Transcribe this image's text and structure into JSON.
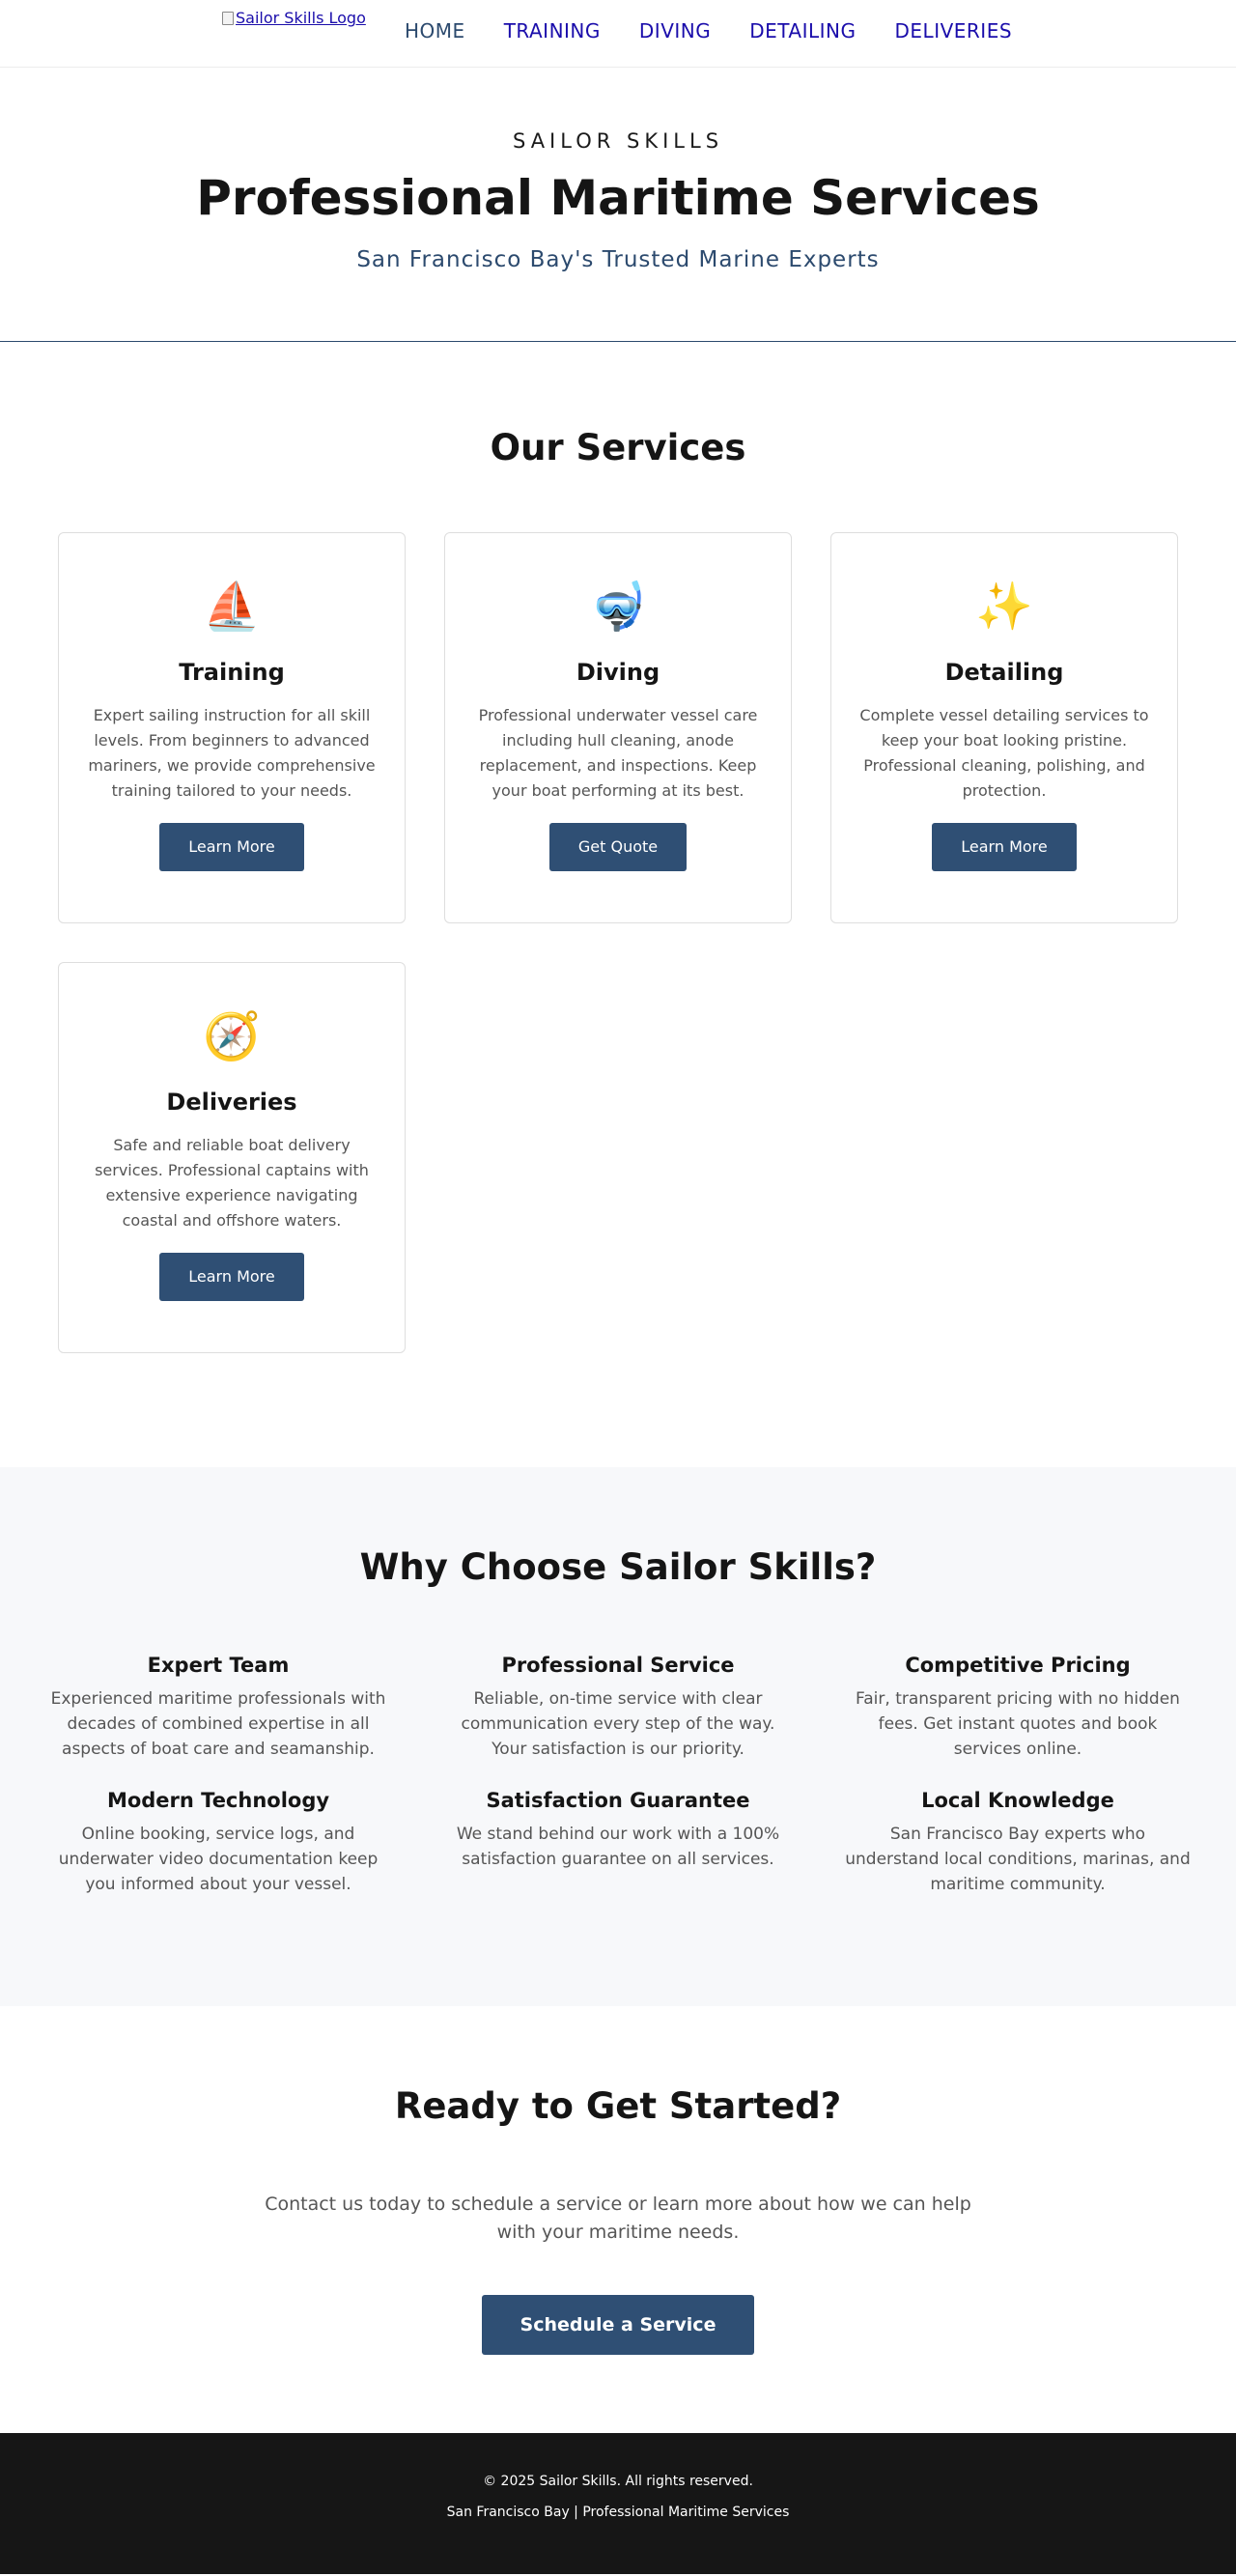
{
  "nav": {
    "logo_alt": "Sailor Skills Logo",
    "links": [
      "HOME",
      "TRAINING",
      "DIVING",
      "DETAILING",
      "DELIVERIES"
    ]
  },
  "hero": {
    "eyebrow": "SAILOR SKILLS",
    "title": "Professional Maritime Services",
    "tagline": "San Francisco Bay's Trusted Marine Experts"
  },
  "services": {
    "title": "Our Services",
    "cards": [
      {
        "icon": "⛵",
        "icon_name": "sailboat-icon",
        "title": "Training",
        "description": "Expert sailing instruction for all skill levels. From beginners to advanced mariners, we provide comprehensive training tailored to your needs.",
        "button": "Learn More"
      },
      {
        "icon": "🤿",
        "icon_name": "diving-mask-icon",
        "title": "Diving",
        "description": "Professional underwater vessel care including hull cleaning, anode replacement, and inspections. Keep your boat performing at its best.",
        "button": "Get Quote"
      },
      {
        "icon": "✨",
        "icon_name": "sparkles-icon",
        "title": "Detailing",
        "description": "Complete vessel detailing services to keep your boat looking pristine. Professional cleaning, polishing, and protection.",
        "button": "Learn More"
      },
      {
        "icon": "🧭",
        "icon_name": "compass-icon",
        "title": "Deliveries",
        "description": "Safe and reliable boat delivery services. Professional captains with extensive experience navigating coastal and offshore waters.",
        "button": "Learn More"
      }
    ]
  },
  "why": {
    "title": "Why Choose Sailor Skills?",
    "features": [
      {
        "title": "Expert Team",
        "text": "Experienced maritime professionals with decades of combined expertise in all aspects of boat care and seamanship."
      },
      {
        "title": "Professional Service",
        "text": "Reliable, on-time service with clear communication every step of the way. Your satisfaction is our priority."
      },
      {
        "title": "Competitive Pricing",
        "text": "Fair, transparent pricing with no hidden fees. Get instant quotes and book services online."
      },
      {
        "title": "Modern Technology",
        "text": "Online booking, service logs, and underwater video documentation keep you informed about your vessel."
      },
      {
        "title": "Satisfaction Guarantee",
        "text": "We stand behind our work with a 100% satisfaction guarantee on all services."
      },
      {
        "title": "Local Knowledge",
        "text": "San Francisco Bay experts who understand local conditions, marinas, and maritime community."
      }
    ]
  },
  "cta": {
    "title": "Ready to Get Started?",
    "text": "Contact us today to schedule a service or learn more about how we can help with your maritime needs.",
    "button": "Schedule a Service"
  },
  "footer": {
    "copyright": "© 2025 Sailor Skills. All rights reserved.",
    "line2": "San Francisco Bay | Professional Maritime Services"
  },
  "colors": {
    "accent": "#2f4f74",
    "link": "#1a0dab",
    "footer_bg": "#161616",
    "section_bg": "#f7f8fa"
  }
}
